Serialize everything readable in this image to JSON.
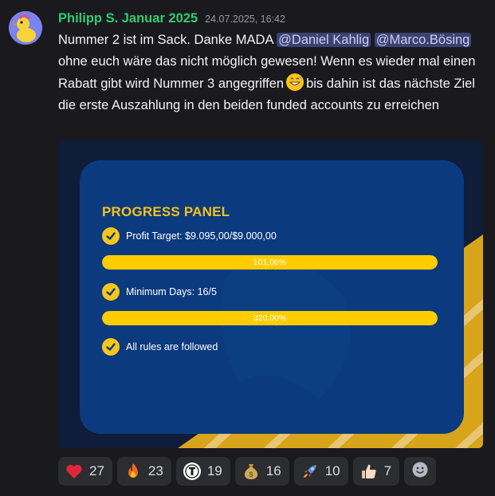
{
  "message": {
    "author": "Philipp S. Januar 2025",
    "timestamp": "24.07.2025, 16:42",
    "author_color": "#2ecc71",
    "text": {
      "part1": "Nummer 2 ist im Sack. Danke MADA ",
      "mention1": "@Daniel Kahlig",
      "mention2": "@Marco.Bösing",
      "part2": " ohne euch wäre das nicht möglich gewesen! Wenn es wieder mal einen Rabatt gibt wird Nummer 3 angegriffen",
      "inline_emoji": "grinning-sweat-emoji",
      "part3": "bis dahin ist das nächste Ziel die erste Auszahlung in den beiden funded accounts zu erreichen"
    }
  },
  "attachment": {
    "panel_title": "PROGRESS PANEL",
    "items": [
      {
        "label": "Profit Target: $9.095,00/$9.000,00",
        "bar_text": "101.06%",
        "progress": 1.0
      },
      {
        "label": "Minimum Days: 16/5",
        "bar_text": "320.00%",
        "progress": 1.0
      },
      {
        "label": "All rules are followed"
      }
    ],
    "colors": {
      "panel": "#0b3a7e",
      "accent": "#ffcc00",
      "title": "#f4c21a"
    }
  },
  "reactions": [
    {
      "icon": "heart-icon",
      "count": "27"
    },
    {
      "icon": "fire-icon",
      "count": "23"
    },
    {
      "icon": "custom-emoji-icon",
      "count": "19"
    },
    {
      "icon": "money-bag-icon",
      "count": "16"
    },
    {
      "icon": "rocket-icon",
      "count": "10"
    },
    {
      "icon": "thumbs-up-icon",
      "count": "7"
    }
  ],
  "add_reaction_icon": "add-reaction-icon"
}
